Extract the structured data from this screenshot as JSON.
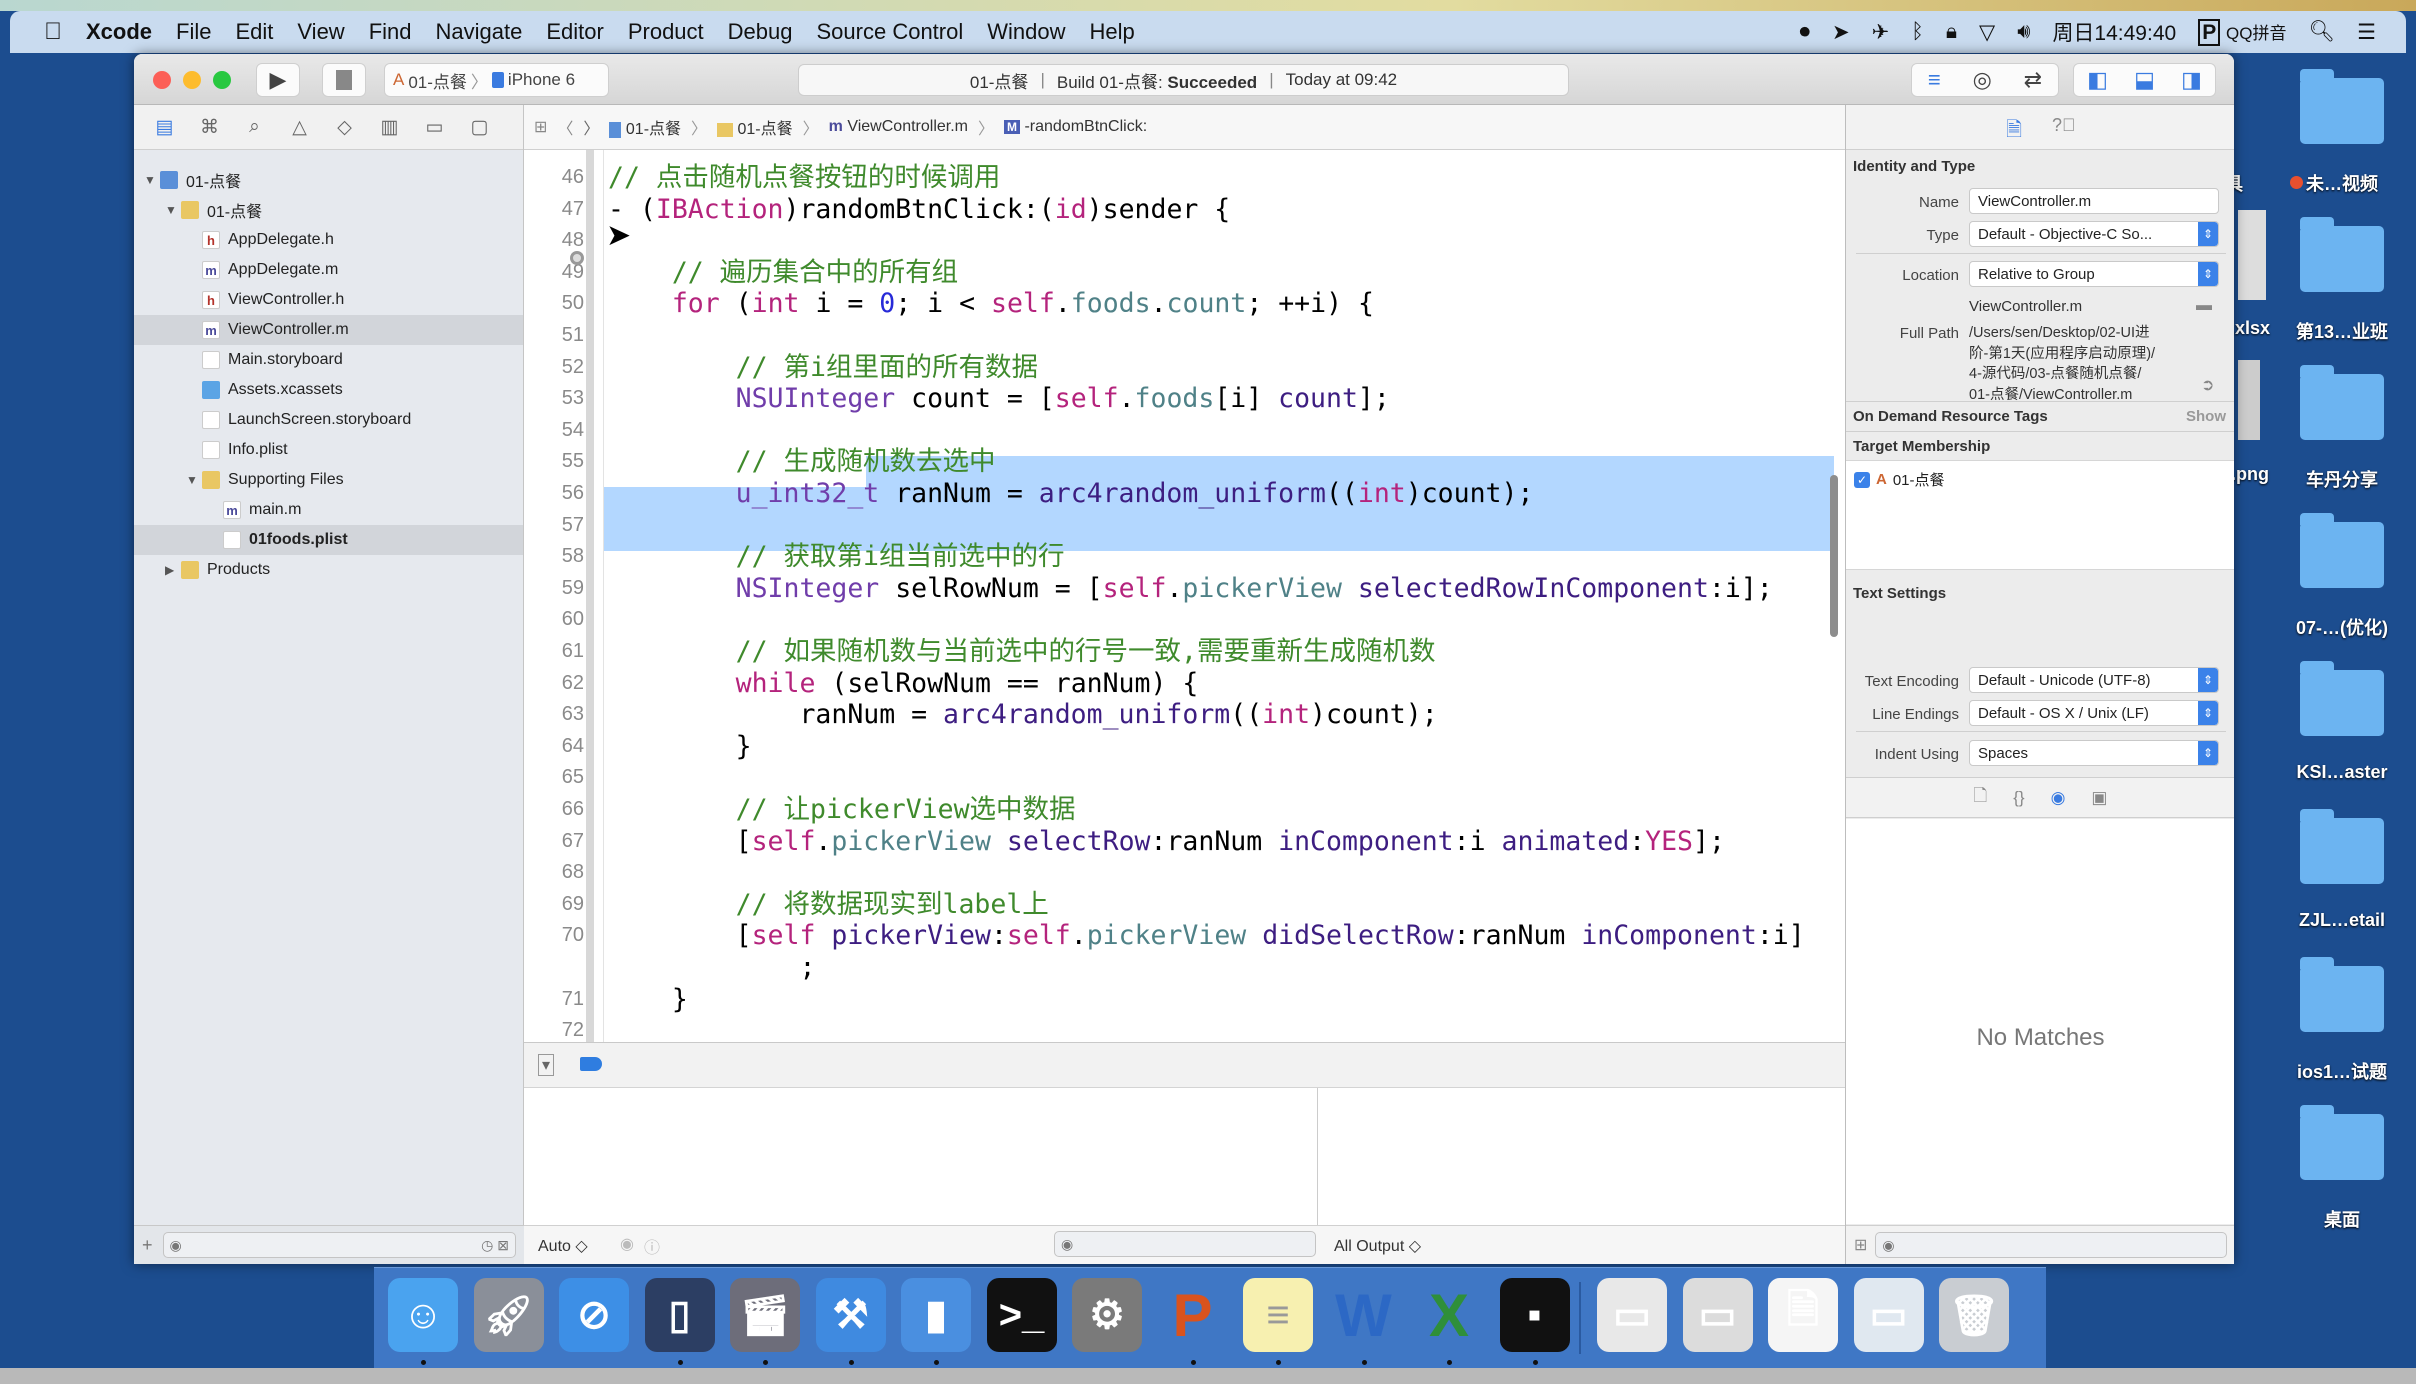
{
  "menubar": {
    "apple_icon": "apple-icon",
    "items": [
      "Xcode",
      "File",
      "Edit",
      "View",
      "Find",
      "Navigate",
      "Editor",
      "Product",
      "Debug",
      "Source Control",
      "Window",
      "Help"
    ],
    "clock": "周日14:49:40",
    "input_method": "QQ拼音"
  },
  "toolbar": {
    "scheme": "01-点餐",
    "device": "iPhone 6",
    "activity": {
      "project": "01-点餐",
      "build_prefix": "Build 01-点餐:",
      "build_status": "Succeeded",
      "time": "Today at 09:42"
    }
  },
  "navigator": {
    "tree": [
      {
        "label": "01-点餐",
        "level": 0,
        "icon": "project",
        "expanded": true
      },
      {
        "label": "01-点餐",
        "level": 1,
        "icon": "folder",
        "expanded": true
      },
      {
        "label": "AppDelegate.h",
        "level": 2,
        "icon": "h"
      },
      {
        "label": "AppDelegate.m",
        "level": 2,
        "icon": "m"
      },
      {
        "label": "ViewController.h",
        "level": 2,
        "icon": "h"
      },
      {
        "label": "ViewController.m",
        "level": 2,
        "icon": "m",
        "selected": true
      },
      {
        "label": "Main.storyboard",
        "level": 2,
        "icon": "file"
      },
      {
        "label": "Assets.xcassets",
        "level": 2,
        "icon": "assets"
      },
      {
        "label": "LaunchScreen.storyboard",
        "level": 2,
        "icon": "file"
      },
      {
        "label": "Info.plist",
        "level": 2,
        "icon": "file"
      },
      {
        "label": "Supporting Files",
        "level": 2,
        "icon": "folder",
        "expanded": true
      },
      {
        "label": "main.m",
        "level": 3,
        "icon": "m"
      },
      {
        "label": "01foods.plist",
        "level": 3,
        "icon": "file",
        "selected": true,
        "bold": true
      },
      {
        "label": "Products",
        "level": 1,
        "icon": "folder",
        "expanded": false
      }
    ]
  },
  "jumpbar": {
    "crumbs": [
      "01-点餐",
      "01-点餐",
      "ViewController.m",
      "-randomBtnClick:"
    ]
  },
  "editor": {
    "lines": [
      {
        "n": "46",
        "seg": [
          [
            "// 点击随机点餐按钮的时候调用",
            "comment"
          ]
        ]
      },
      {
        "n": "47",
        "seg": [
          [
            "- (",
            "plain"
          ],
          [
            "IBAction",
            "kw"
          ],
          [
            ")randomBtnClick:(",
            "plain"
          ],
          [
            "id",
            "kw"
          ],
          [
            ")sender {",
            "plain"
          ]
        ]
      },
      {
        "n": "48",
        "seg": []
      },
      {
        "n": "49",
        "seg": [
          [
            "    // 遍历集合中的所有组",
            "comment"
          ]
        ]
      },
      {
        "n": "50",
        "seg": [
          [
            "    ",
            "plain"
          ],
          [
            "for",
            "kw"
          ],
          [
            " (",
            "plain"
          ],
          [
            "int",
            "kw"
          ],
          [
            " i = ",
            "plain"
          ],
          [
            "0",
            "num"
          ],
          [
            "; i < ",
            "plain"
          ],
          [
            "self",
            "kw"
          ],
          [
            ".",
            "plain"
          ],
          [
            "foods",
            "prop"
          ],
          [
            ".",
            "plain"
          ],
          [
            "count",
            "prop"
          ],
          [
            "; ++i) {",
            "plain"
          ]
        ]
      },
      {
        "n": "51",
        "seg": []
      },
      {
        "n": "52",
        "seg": [
          [
            "        // 第i组里面的所有数据",
            "comment"
          ]
        ]
      },
      {
        "n": "53",
        "seg": [
          [
            "        ",
            "plain"
          ],
          [
            "NSUInteger",
            "type"
          ],
          [
            " count = [",
            "plain"
          ],
          [
            "self",
            "kw"
          ],
          [
            ".",
            "plain"
          ],
          [
            "foods",
            "prop"
          ],
          [
            "[i] ",
            "plain"
          ],
          [
            "count",
            "method"
          ],
          [
            "];",
            "plain"
          ]
        ]
      },
      {
        "n": "54",
        "seg": []
      },
      {
        "n": "55",
        "seg": [
          [
            "        // 生成随机数去选中",
            "comment"
          ]
        ]
      },
      {
        "n": "56",
        "seg": [
          [
            "        ",
            "plain"
          ],
          [
            "u_int32_t",
            "type"
          ],
          [
            " ranNum = ",
            "plain"
          ],
          [
            "arc4random_uniform",
            "method"
          ],
          [
            "((",
            "plain"
          ],
          [
            "int",
            "kw"
          ],
          [
            ")count);",
            "plain"
          ]
        ]
      },
      {
        "n": "57",
        "seg": []
      },
      {
        "n": "58",
        "seg": [
          [
            "        // 获取第i组当前选中的行",
            "comment"
          ]
        ]
      },
      {
        "n": "59",
        "seg": [
          [
            "        ",
            "plain"
          ],
          [
            "NSInteger",
            "type"
          ],
          [
            " selRowNum = [",
            "plain"
          ],
          [
            "self",
            "kw"
          ],
          [
            ".",
            "plain"
          ],
          [
            "pickerView",
            "prop"
          ],
          [
            " ",
            "plain"
          ],
          [
            "selectedRowInComponent",
            "method"
          ],
          [
            ":i];",
            "plain"
          ]
        ]
      },
      {
        "n": "60",
        "seg": []
      },
      {
        "n": "61",
        "seg": [
          [
            "        // 如果随机数与当前选中的行号一致,需要重新生成随机数",
            "comment"
          ]
        ]
      },
      {
        "n": "62",
        "seg": [
          [
            "        ",
            "plain"
          ],
          [
            "while",
            "kw"
          ],
          [
            " (selRowNum == ranNum) {",
            "plain"
          ]
        ]
      },
      {
        "n": "63",
        "seg": [
          [
            "            ranNum = ",
            "plain"
          ],
          [
            "arc4random_uniform",
            "method"
          ],
          [
            "((",
            "plain"
          ],
          [
            "int",
            "kw"
          ],
          [
            ")count);",
            "plain"
          ]
        ]
      },
      {
        "n": "64",
        "seg": [
          [
            "        }",
            "plain"
          ]
        ]
      },
      {
        "n": "65",
        "seg": []
      },
      {
        "n": "66",
        "seg": [
          [
            "        // 让pickerView选中数据",
            "comment"
          ]
        ]
      },
      {
        "n": "67",
        "seg": [
          [
            "        [",
            "plain"
          ],
          [
            "self",
            "kw"
          ],
          [
            ".",
            "plain"
          ],
          [
            "pickerView",
            "prop"
          ],
          [
            " ",
            "plain"
          ],
          [
            "selectRow",
            "method"
          ],
          [
            ":ranNum ",
            "plain"
          ],
          [
            "inComponent",
            "method"
          ],
          [
            ":i ",
            "plain"
          ],
          [
            "animated",
            "method"
          ],
          [
            ":",
            "plain"
          ],
          [
            "YES",
            "kw"
          ],
          [
            "];",
            "plain"
          ]
        ]
      },
      {
        "n": "68",
        "seg": []
      },
      {
        "n": "69",
        "seg": [
          [
            "        // 将数据现实到label上",
            "comment"
          ]
        ]
      },
      {
        "n": "70",
        "seg": [
          [
            "        [",
            "plain"
          ],
          [
            "self",
            "kw"
          ],
          [
            " ",
            "plain"
          ],
          [
            "pickerView",
            "method"
          ],
          [
            ":",
            "plain"
          ],
          [
            "self",
            "kw"
          ],
          [
            ".",
            "plain"
          ],
          [
            "pickerView",
            "prop"
          ],
          [
            " ",
            "plain"
          ],
          [
            "didSelectRow",
            "method"
          ],
          [
            ":ranNum ",
            "plain"
          ],
          [
            "inComponent",
            "method"
          ],
          [
            ":i]",
            "plain"
          ]
        ]
      },
      {
        "n": "",
        "seg": [
          [
            "            ;",
            "plain"
          ]
        ]
      },
      {
        "n": "71",
        "seg": [
          [
            "    }",
            "plain"
          ]
        ]
      },
      {
        "n": "72",
        "seg": []
      }
    ],
    "colors": {
      "comment": "#3f8a2c",
      "keyword": "#b4237c",
      "selection": "#b3d7ff"
    }
  },
  "debug": {
    "auto_label": "Auto ◇",
    "output_label": "All Output ◇"
  },
  "inspector": {
    "identity_title": "Identity and Type",
    "name_label": "Name",
    "name_value": "ViewController.m",
    "type_label": "Type",
    "type_value": "Default - Objective-C So...",
    "location_label": "Location",
    "location_value": "Relative to Group",
    "location_file": "ViewController.m",
    "fullpath_label": "Full Path",
    "fullpath_lines": [
      "/Users/sen/Desktop/02-UI进",
      "阶-第1天(应用程序启动原理)/",
      "4-源代码/03-点餐随机点餐/",
      "01-点餐/ViewController.m"
    ],
    "odr_title": "On Demand Resource Tags",
    "odr_show": "Show",
    "target_title": "Target Membership",
    "target_item": "01-点餐",
    "target_checked": true,
    "text_title": "Text Settings",
    "encoding_label": "Text Encoding",
    "encoding_value": "Default - Unicode (UTF-8)",
    "endings_label": "Line Endings",
    "endings_value": "Default - OS X / Unix (LF)",
    "indent_label": "Indent Using",
    "indent_value": "Spaces",
    "no_matches": "No Matches"
  },
  "desktop": {
    "partial_labels": [
      "工具",
      ".xlsx",
      ".png"
    ],
    "folders": [
      "未…视频",
      "第13…业班",
      "车丹分享",
      "07-…(优化)",
      "KSI…aster",
      "ZJL…etail",
      "ios1…试题",
      "桌面"
    ]
  },
  "dock": {
    "apps": [
      "finder",
      "launchpad",
      "safari",
      "mouse",
      "imovie",
      "xcode",
      "simulator",
      "terminal",
      "system-preferences",
      "powerpoint",
      "notes",
      "word",
      "excel",
      "console",
      "window-1",
      "window-2",
      "document",
      "preview",
      "trash"
    ]
  }
}
